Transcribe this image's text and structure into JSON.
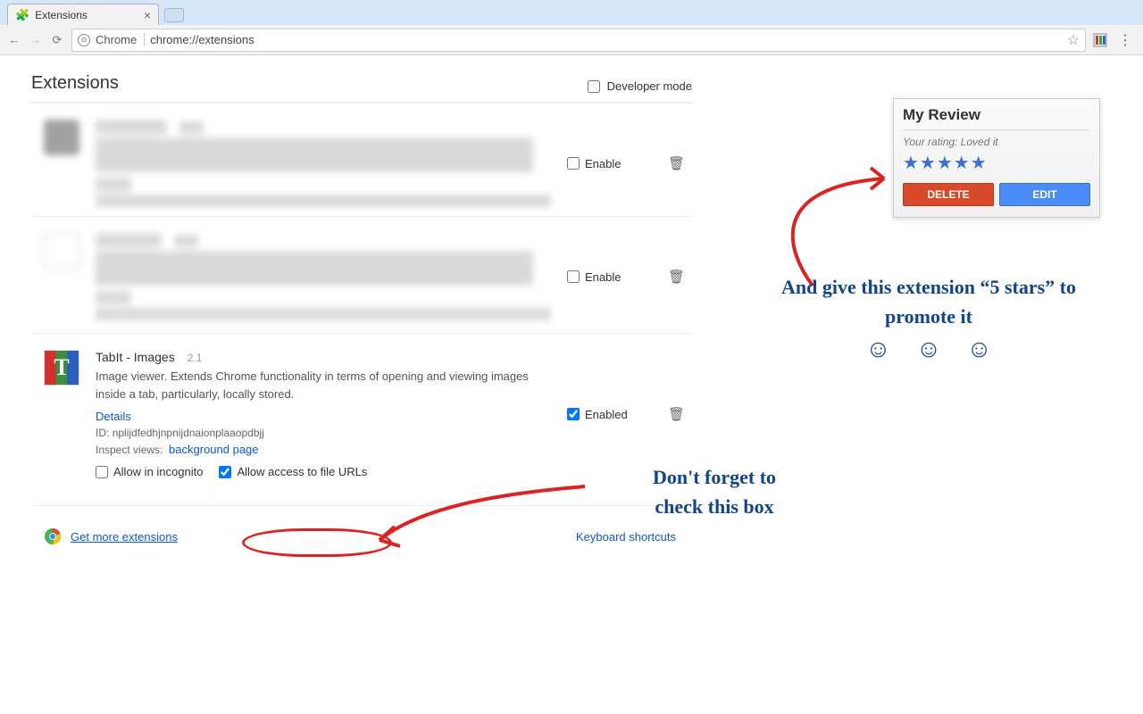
{
  "browser": {
    "tab_title": "Extensions",
    "omnibox_chip": "Chrome",
    "omnibox_url": "chrome://extensions"
  },
  "page": {
    "title": "Extensions",
    "developer_mode_label": "Developer mode"
  },
  "blurred1": {
    "enable_label": "Enable"
  },
  "blurred2": {
    "enable_label": "Enable"
  },
  "tabit": {
    "name": "TabIt - Images",
    "version": "2.1",
    "description": "Image viewer. Extends Chrome functionality in terms of opening and viewing images inside a tab, particularly, locally stored.",
    "details_link": "Details",
    "id_label": "ID:",
    "id_value": "nplijdfedhjnpnijdnaionplaaopdbjj",
    "inspect_label": "Inspect views:",
    "inspect_link": "background page",
    "enabled_label": "Enabled",
    "allow_incognito": "Allow in incognito",
    "allow_file_urls": "Allow access to file URLs"
  },
  "footer": {
    "more": "Get more extensions",
    "shortcuts": "Keyboard shortcuts"
  },
  "review": {
    "title": "My Review",
    "sub": "Your rating: Loved it",
    "stars": "★★★★★",
    "delete": "DELETE",
    "edit": "EDIT"
  },
  "anno": {
    "text1": "And give this extension “5 stars” to promote it",
    "smileys": "☺ ☺ ☺",
    "text2a": "Don't forget to",
    "text2b": "check this box"
  }
}
